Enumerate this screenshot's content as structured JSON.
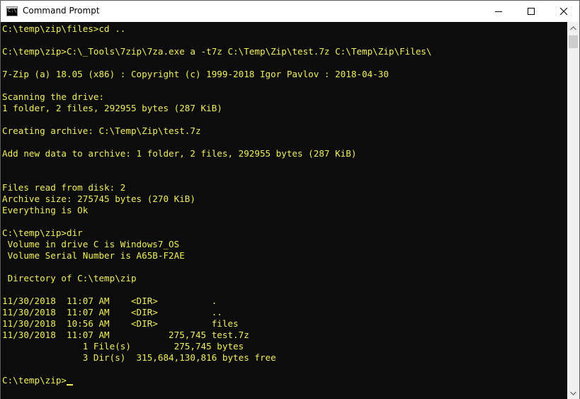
{
  "window": {
    "title": "Command Prompt",
    "icon_name": "console-icon",
    "icon_glyph": "C:\\",
    "controls": {
      "minimize": "minimize-icon",
      "maximize": "maximize-icon",
      "close": "close-icon"
    }
  },
  "console": {
    "foreground_color": "#f0ef5c",
    "background_color": "#0c0c0c",
    "lines": [
      "C:\\temp\\zip\\files>cd ..",
      "",
      "C:\\temp\\zip>C:\\_Tools\\7zip\\7za.exe a -t7z C:\\Temp\\Zip\\test.7z C:\\Temp\\Zip\\Files\\",
      "",
      "7-Zip (a) 18.05 (x86) : Copyright (c) 1999-2018 Igor Pavlov : 2018-04-30",
      "",
      "Scanning the drive:",
      "1 folder, 2 files, 292955 bytes (287 KiB)",
      "",
      "Creating archive: C:\\Temp\\Zip\\test.7z",
      "",
      "Add new data to archive: 1 folder, 2 files, 292955 bytes (287 KiB)",
      "",
      "",
      "Files read from disk: 2",
      "Archive size: 275745 bytes (270 KiB)",
      "Everything is Ok",
      "",
      "C:\\temp\\zip>dir",
      " Volume in drive C is Windows7_OS",
      " Volume Serial Number is A65B-F2AE",
      "",
      " Directory of C:\\temp\\zip",
      "",
      "11/30/2018  11:07 AM    <DIR>          .",
      "11/30/2018  11:07 AM    <DIR>          ..",
      "11/30/2018  10:56 AM    <DIR>          files",
      "11/30/2018  11:07 AM           275,745 test.7z",
      "               1 File(s)        275,745 bytes",
      "               3 Dir(s)  315,684,130,816 bytes free",
      ""
    ],
    "prompt": "C:\\temp\\zip>"
  },
  "scrollbar": {
    "up_icon": "scroll-up-arrow-icon",
    "down_icon": "scroll-down-arrow-icon"
  }
}
